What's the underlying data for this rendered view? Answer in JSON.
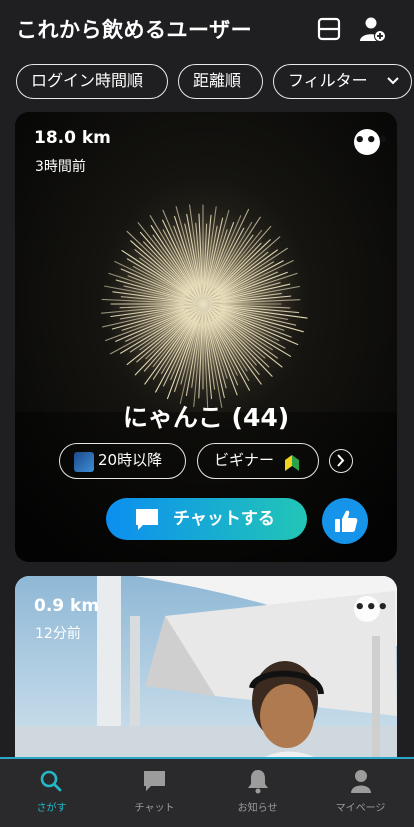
{
  "header": {
    "title": "これから飲めるユーザー"
  },
  "filters": [
    {
      "label": "ログイン時間順"
    },
    {
      "label": "距離順"
    },
    {
      "label": "フィルター"
    }
  ],
  "cards": [
    {
      "distance": "18.0 km",
      "time_ago": "3時間前",
      "name": "にゃんこ (44)",
      "tags": [
        "20時以降",
        "ビギナー"
      ],
      "chat_label": "チャットする"
    },
    {
      "distance": "0.9 km",
      "time_ago": "12分前"
    }
  ],
  "tabbar": {
    "items": [
      {
        "label": "さがす",
        "active": true
      },
      {
        "label": "チャット"
      },
      {
        "label": "お知らせ"
      },
      {
        "label": "マイページ"
      }
    ]
  },
  "colors": {
    "accent": "#26b7c7",
    "chat_gradient_start": "#0c8ff0",
    "chat_gradient_end": "#22c6b6",
    "like": "#1594ea",
    "background": "#1f1f21"
  },
  "icons": [
    "layout-split-icon",
    "add-user-icon",
    "chevron-down-icon",
    "more-icon",
    "chevron-right-icon",
    "chat-bubble-icon",
    "thumbs-up-icon",
    "search-icon",
    "bell-icon",
    "person-icon"
  ]
}
